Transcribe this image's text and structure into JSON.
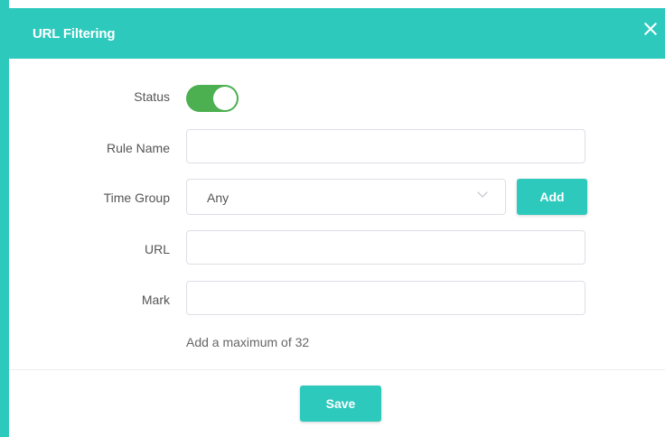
{
  "dialog": {
    "title": "URL Filtering"
  },
  "form": {
    "status_label": "Status",
    "status_on": true,
    "rule_name_label": "Rule Name",
    "rule_name_value": "",
    "time_group_label": "Time Group",
    "time_group_value": "Any",
    "add_label": "Add",
    "url_label": "URL",
    "url_value": "",
    "mark_label": "Mark",
    "mark_value": "",
    "hint": "Add a maximum of 32"
  },
  "footer": {
    "save_label": "Save"
  },
  "colors": {
    "accent": "#2ec9bd",
    "toggle_on": "#4caf50"
  }
}
